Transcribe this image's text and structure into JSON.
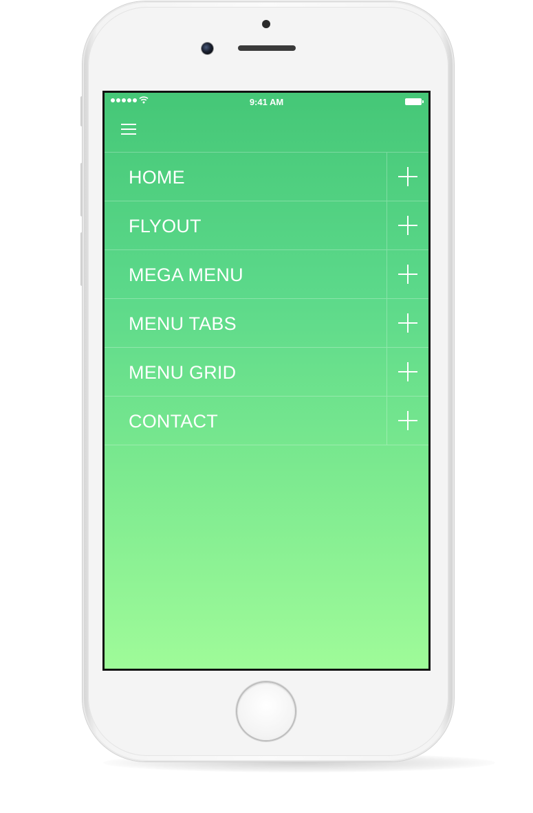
{
  "status_bar": {
    "time": "9:41 AM"
  },
  "icons": {
    "signal": "signal-dots-icon",
    "wifi": "wifi-icon",
    "battery": "battery-icon",
    "menu": "hamburger-menu-icon",
    "expand": "plus-icon"
  },
  "menu": {
    "items": [
      {
        "label": "HOME"
      },
      {
        "label": "FLYOUT"
      },
      {
        "label": "MEGA MENU"
      },
      {
        "label": "MENU TABS"
      },
      {
        "label": "MENU GRID"
      },
      {
        "label": "CONTACT"
      }
    ]
  },
  "colors": {
    "gradient_top": "#45c777",
    "gradient_bottom": "#9ffb99",
    "text": "#ffffff"
  }
}
